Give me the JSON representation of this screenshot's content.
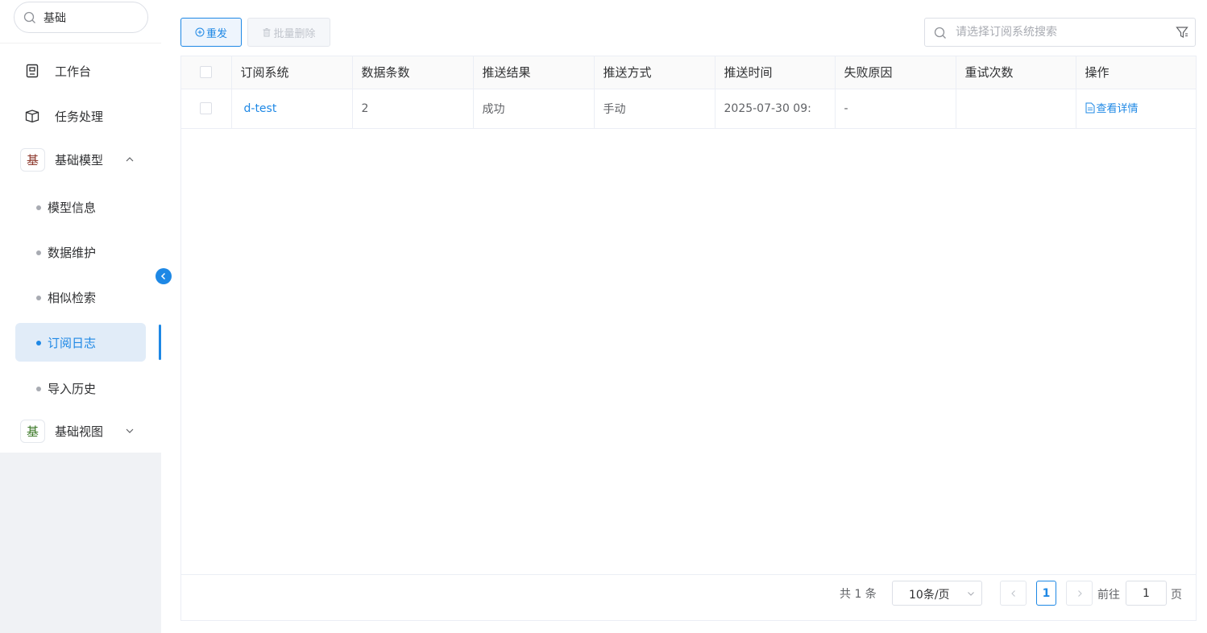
{
  "sidebar": {
    "search_value": "基础",
    "menu": {
      "workbench": "工作台",
      "tasks": "任务处理",
      "base_model": {
        "badge": "基",
        "label": "基础模型"
      },
      "base_view": {
        "badge": "基",
        "label": "基础视图"
      }
    },
    "sub_items": [
      "模型信息",
      "数据维护",
      "相似检索",
      "订阅日志",
      "导入历史"
    ],
    "active_item": "订阅日志"
  },
  "toolbar": {
    "resend_label": "重发",
    "batch_delete_label": "批量删除",
    "search_placeholder": "请选择订阅系统搜索"
  },
  "table": {
    "columns": [
      "订阅系统",
      "数据条数",
      "推送结果",
      "推送方式",
      "推送时间",
      "失败原因",
      "重试次数",
      "操作"
    ],
    "rows": [
      {
        "system": "d-test",
        "count": "2",
        "result": "成功",
        "method": "手动",
        "time": "2025-07-30 09:",
        "reason": "-",
        "retries": "",
        "action": "查看详情"
      }
    ]
  },
  "pagination": {
    "total_text": "共 1 条",
    "page_size": "10条/页",
    "current_page": "1",
    "goto_label": "前往",
    "goto_value": "1",
    "page_suffix": "页"
  },
  "colors": {
    "accent": "#1e88e5",
    "badge_model": "#8d3a2e",
    "badge_view": "#3e7a2a"
  }
}
